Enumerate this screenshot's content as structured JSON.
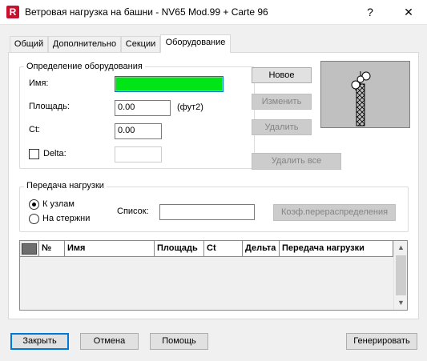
{
  "window": {
    "title": "Ветровая нагрузка на башни - NV65 Mod.99 + Carte 96",
    "app_icon_letter": "R",
    "help_glyph": "?",
    "close_glyph": "✕"
  },
  "tabs": [
    {
      "label": "Общий"
    },
    {
      "label": "Дополнительно"
    },
    {
      "label": "Секции"
    },
    {
      "label": "Оборудование"
    }
  ],
  "equipment_definition": {
    "group_label": "Определение оборудования",
    "name_label": "Имя:",
    "name_value": "",
    "area_label": "Площадь:",
    "area_value": "0.00",
    "area_unit": "(фут2)",
    "ct_label": "Ct:",
    "ct_value": "0.00",
    "delta_label": "Delta:",
    "delta_value": ""
  },
  "actions": {
    "new_label": "Новое",
    "modify_label": "Изменить",
    "delete_label": "Удалить",
    "delete_all_label": "Удалить все"
  },
  "load_transfer": {
    "group_label": "Передача нагрузки",
    "to_nodes_label": "К узлам",
    "to_bars_label": "На стержни",
    "list_label": "Список:",
    "list_value": "",
    "coef_button_label": "Коэф.перераспределения"
  },
  "table": {
    "columns": [
      "№",
      "Имя",
      "Площадь",
      "Ct",
      "Дельта",
      "Передача нагрузки"
    ],
    "rows": [],
    "scroll_up": "▲",
    "scroll_down": "▼"
  },
  "footer": {
    "close_label": "Закрыть",
    "cancel_label": "Отмена",
    "help_label": "Помощь",
    "generate_label": "Генерировать"
  },
  "colors": {
    "name_field_fill": "#00e515",
    "focus_border": "#0078d7",
    "preview_bg": "#c0c0c0"
  }
}
